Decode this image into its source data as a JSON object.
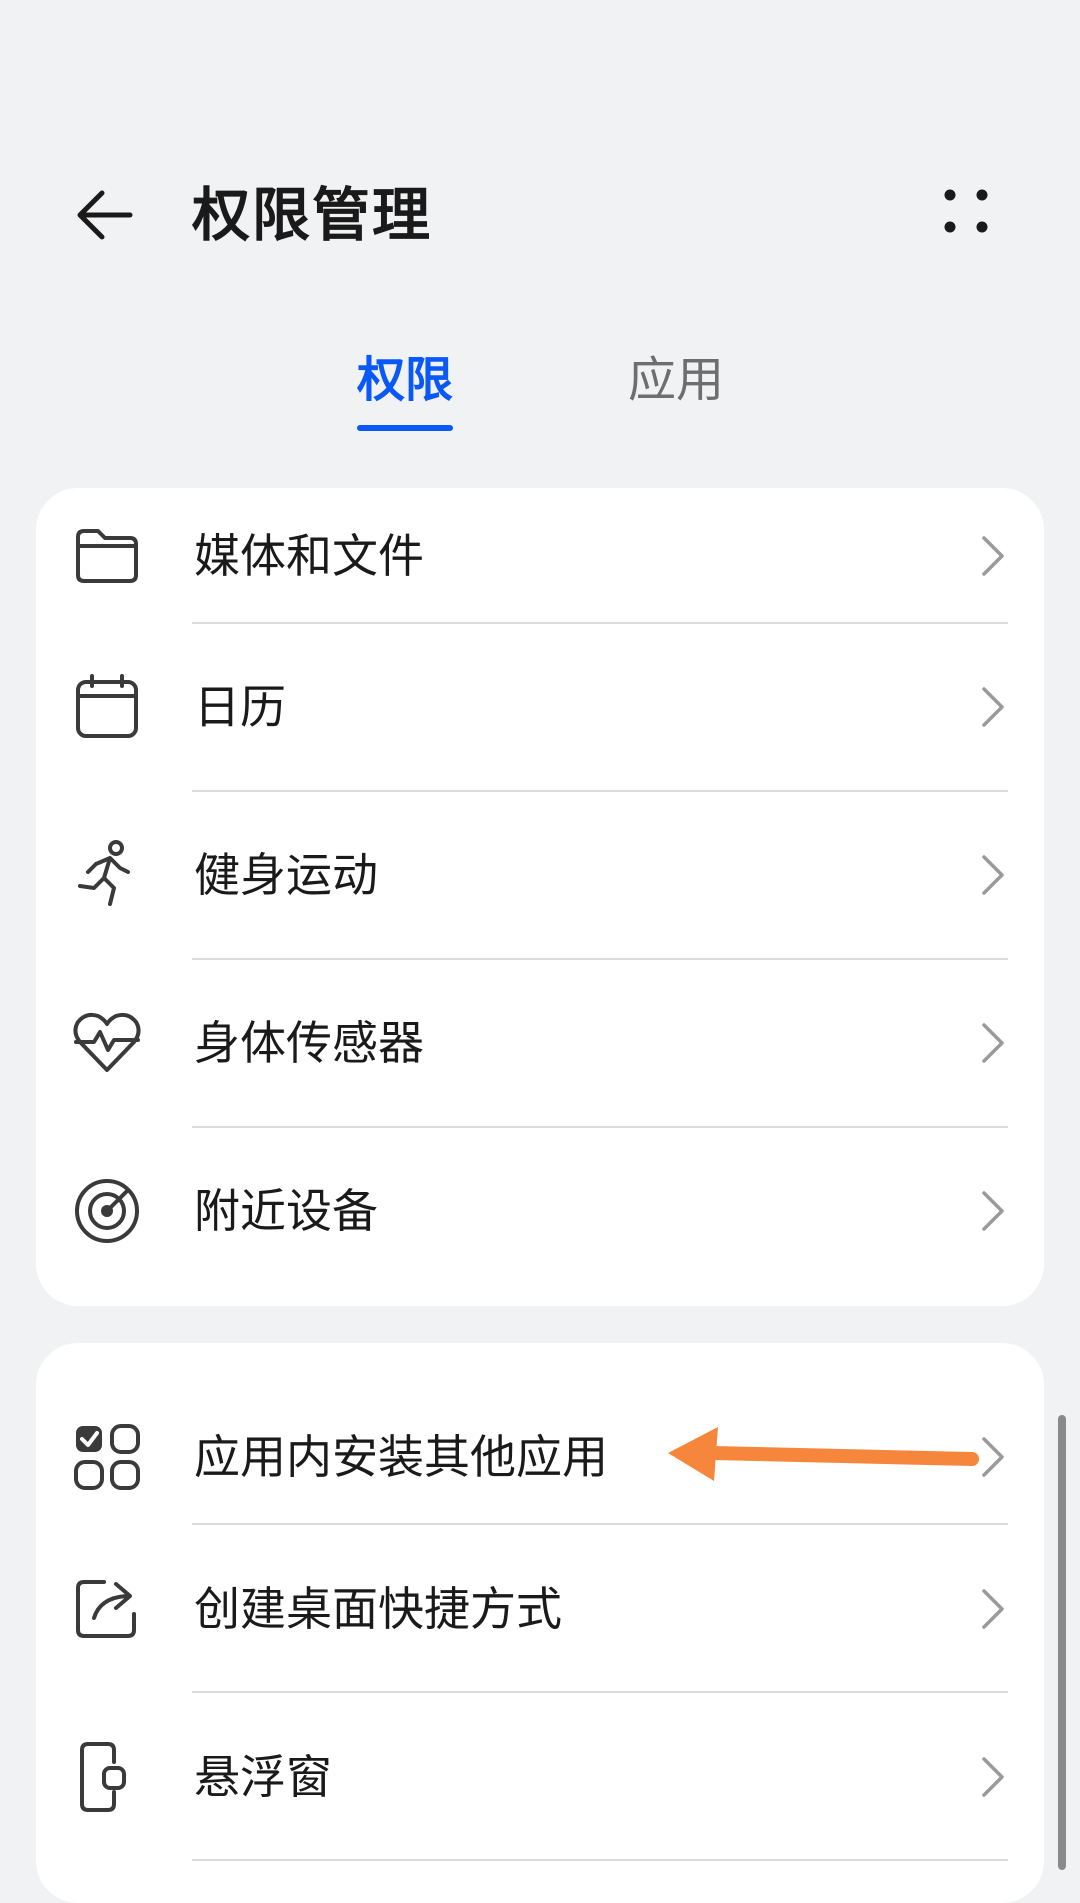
{
  "header": {
    "title": "权限管理"
  },
  "tabs": [
    {
      "label": "权限",
      "active": true
    },
    {
      "label": "应用",
      "active": false
    }
  ],
  "colors": {
    "accent": "#0a59f7",
    "annotation_arrow": "#f5863c"
  },
  "sections": [
    {
      "items": [
        {
          "label": "媒体和文件",
          "icon": "folder-icon"
        },
        {
          "label": "日历",
          "icon": "calendar-icon"
        },
        {
          "label": "健身运动",
          "icon": "running-person-icon"
        },
        {
          "label": "身体传感器",
          "icon": "heart-pulse-icon"
        },
        {
          "label": "附近设备",
          "icon": "radar-icon"
        }
      ]
    },
    {
      "items": [
        {
          "label": "应用内安装其他应用",
          "icon": "apps-grid-check-icon"
        },
        {
          "label": "创建桌面快捷方式",
          "icon": "share-forward-icon"
        },
        {
          "label": "悬浮窗",
          "icon": "floating-window-icon"
        }
      ]
    }
  ]
}
